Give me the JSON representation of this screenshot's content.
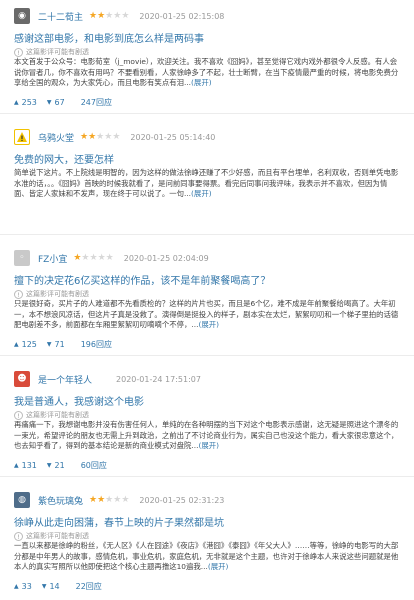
{
  "reviews": [
    {
      "username": "二十二荀主",
      "stars": 2,
      "date": "2020-01-25 02:15:08",
      "title": "感谢这部电影，和电影到底怎么样是两码事",
      "spoiler": "这篇影评可能有剧透",
      "excerpt": "本文首发于公众号：电影荀室（j_movie），欢迎关注。我不喜欢《囧妈》，甚至觉得它戏内戏外都很令人反感。有人会说你冒者几，你不喜欢有用吗？不要看别看，人家徐峥多了不起，壮士断臂，在当下疫情最严重的时候，将电影免费分享给全国的观众，为大家凭心，而且电影有笑点有泪...",
      "expand": "(展开)",
      "up": "253",
      "down": "67",
      "replies": "247回应"
    },
    {
      "username": "乌鸦火堂",
      "stars": 2,
      "date": "2020-01-25 05:14:40",
      "title": "免费的网大，还要怎样",
      "spoiler": "",
      "excerpt": "简单说下这片。不上院线是明智的，因为这样的做法徐峥还赚了不少好感，而且有平台埋单，名利双收，否则单凭电影水准的话，。。《囧妈》首映的时候我就看了，是问前同事要得票。看完后同事问我评味，我表示并不喜欢，但因为情面、皆定人家妹和不发声，现在终于可以说了。一句...",
      "expand": "(展开)",
      "up": "",
      "down": "",
      "replies": ""
    },
    {
      "username": "FZ小宜",
      "stars": 1,
      "date": "2020-01-25 02:04:09",
      "title": "擅下的决定花6亿买这样的作品，该不是年前聚餐喝高了？",
      "spoiler": "这篇影评可能有剧透",
      "excerpt": "只是很好奇，买片子的人难道都不先看质检的？这样的片片也买，而且是6个亿，难不成是年前聚餐给喝高了。大年初一，本不想浪风凉话，但这片子真是没救了。演得倒是挺投入的样子，剧本实在太烂，絮絮叨叨和一个梯子里拍的话德肥电剧差不多，前面都在车厢里絮絮叨叨嘀嘀个不停，...",
      "expand": "(展开)",
      "up": "125",
      "down": "71",
      "replies": "196回应"
    },
    {
      "username": "是一个年轻人",
      "stars": 0,
      "date": "2020-01-24 17:51:07",
      "title": "我是普通人，我感谢这个电影",
      "spoiler": "这篇影评可能有剧透",
      "excerpt": "再痛痛一下，我想谢电影并没有伤害任何人，单纯的在各种明摆的当下对这个电影表示感谢，这无疑是照进这个漂冬的一束光，希望评论的朋友也无需上升到政治，之前出了不讨论商业行为，属实自己也没这个能力，看大家很忠意这个，也去知乎看了，得到的基本结论是新的商业模式对盘院...",
      "expand": "(展开)",
      "up": "131",
      "down": "21",
      "replies": "60回应"
    },
    {
      "username": "紫色玩璃兔",
      "stars": 2,
      "date": "2020-01-25 02:31:23",
      "title": "徐峥从此走向困蒲，春节上映的片子果然都是坑",
      "spoiler": "这篇影评可能有剧透",
      "excerpt": "一直以来都是徐峥的粉丝，《无人区》《人在囧途》《夜店》《港囧》《泰囧》《年父大人》……等等，徐峥的电影写的大部分都是中年男人的故事，感情危机，事业危机，家庭危机，无非就是这个主题，也许对于徐峥本人来说这些问题就是他本人的真实写照所以他即使把这个核心主题再撸这10遍我...",
      "expand": "(展开)",
      "up": "33",
      "down": "14",
      "replies": "22回应"
    }
  ]
}
